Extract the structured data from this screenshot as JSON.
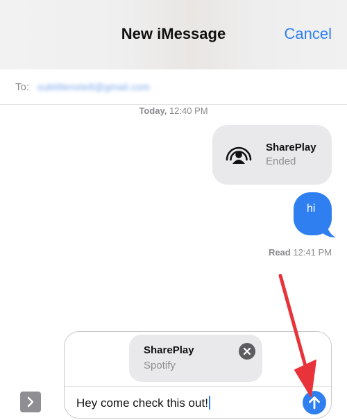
{
  "header": {
    "title": "New iMessage",
    "cancel_label": "Cancel"
  },
  "recipient": {
    "label": "To:",
    "value": "subtitlenote8@gmail.com"
  },
  "thread": {
    "timestamp_day": "Today,",
    "timestamp_time": " 12:40 PM",
    "shareplay_message": {
      "title": "SharePlay",
      "status": "Ended",
      "icon": "shareplay-icon"
    },
    "sent_message": {
      "text": "hi"
    },
    "receipt_status": "Read",
    "receipt_time": " 12:41 PM"
  },
  "compose": {
    "attachment": {
      "title": "SharePlay",
      "subtitle": "Spotify",
      "remove_icon": "close-icon"
    },
    "text": "Hey come check this out!",
    "send_icon": "arrow-up-icon",
    "apps_icon": "chevron-right-icon"
  },
  "colors": {
    "accent": "#2f7ff0",
    "annotation": "#e8333b",
    "bubble_gray": "#e9e9eb"
  }
}
